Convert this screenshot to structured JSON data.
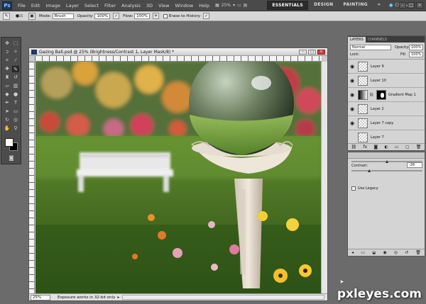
{
  "app": {
    "logo": "Ps",
    "menus": [
      "File",
      "Edit",
      "Image",
      "Layer",
      "Select",
      "Filter",
      "Analysis",
      "3D",
      "View",
      "Window",
      "Help"
    ],
    "zoom_display": "25%",
    "workspaces": [
      {
        "label": "ESSENTIALS",
        "active": true
      },
      {
        "label": "DESIGN",
        "active": false
      },
      {
        "label": "PAINTING",
        "active": false
      }
    ],
    "more": "»",
    "cs_live": "CS Live"
  },
  "options": {
    "mode_label": "Mode:",
    "mode_value": "Brush",
    "opacity_label": "Opacity:",
    "opacity_value": "100%",
    "flow_label": "Flow:",
    "flow_value": "100%",
    "erase_history": "Erase to History",
    "brush_size": "25"
  },
  "document": {
    "title": "Gazing Ball.psd @ 25% (Brightness/Contrast 1, Layer Mask/8) *",
    "zoom": "25%",
    "status": "Exposure works in 32-bit only"
  },
  "layers_panel": {
    "tabs": [
      {
        "label": "LAYERS",
        "active": true
      },
      {
        "label": "CHANNELS",
        "active": false
      }
    ],
    "blend_mode": "Normal",
    "opacity_label": "Opacity:",
    "opacity_value": "100%",
    "fill_label": "Fill:",
    "fill_value": "100%",
    "lock_label": "Lock:",
    "layers": [
      {
        "name": "Layer 9",
        "visible": true,
        "type": "pixel",
        "selected": false
      },
      {
        "name": "Layer 10",
        "visible": true,
        "type": "pixel",
        "selected": false
      },
      {
        "name": "Gradient Map 1",
        "visible": true,
        "type": "adjustment",
        "selected": false
      },
      {
        "name": "Layer 2",
        "visible": true,
        "type": "pixel",
        "selected": false
      },
      {
        "name": "Layer 7 copy",
        "visible": true,
        "type": "pixel",
        "selected": false
      },
      {
        "name": "Layer 7",
        "visible": false,
        "type": "pixel",
        "selected": false
      }
    ]
  },
  "adjustments_panel": {
    "contrast_label": "Contrast:",
    "contrast_value": "-26",
    "use_legacy": "Use Legacy"
  },
  "watermark": "pxleyes.com",
  "colors": {
    "chrome_dark": "#4a4a4a",
    "panel_light": "#d4d4d4",
    "foreground": "#ffffff",
    "background": "#000000"
  }
}
